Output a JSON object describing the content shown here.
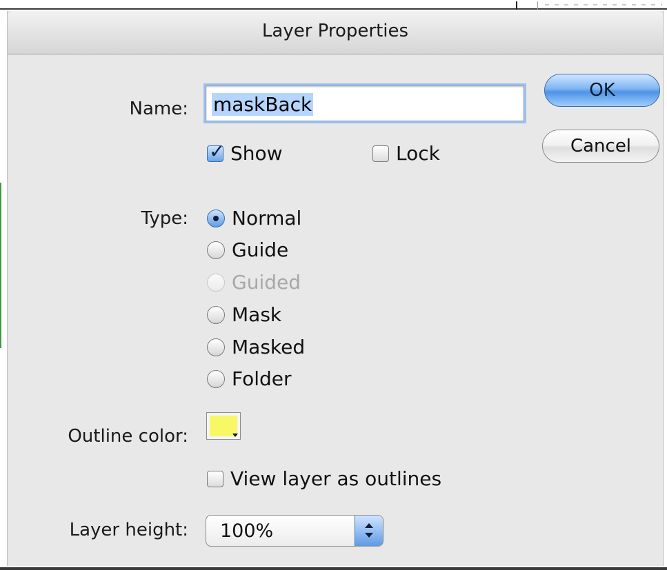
{
  "dialog": {
    "title": "Layer Properties"
  },
  "name_field": {
    "label": "Name:",
    "value": "maskBack"
  },
  "buttons": {
    "ok": "OK",
    "cancel": "Cancel"
  },
  "options": {
    "show": {
      "label": "Show",
      "checked": true
    },
    "lock": {
      "label": "Lock",
      "checked": false
    }
  },
  "type": {
    "label": "Type:",
    "choices": [
      {
        "label": "Normal",
        "selected": true,
        "enabled": true
      },
      {
        "label": "Guide",
        "selected": false,
        "enabled": true
      },
      {
        "label": "Guided",
        "selected": false,
        "enabled": false
      },
      {
        "label": "Mask",
        "selected": false,
        "enabled": true
      },
      {
        "label": "Masked",
        "selected": false,
        "enabled": true
      },
      {
        "label": "Folder",
        "selected": false,
        "enabled": true
      }
    ]
  },
  "outline": {
    "label": "Outline color:",
    "color": "#f8f866",
    "view_as_outlines": {
      "label": "View layer as outlines",
      "checked": false
    }
  },
  "layer_height": {
    "label": "Layer height:",
    "value": "100%"
  },
  "icons": {
    "popup_stepper": "up-down-arrows-icon",
    "swatch_dropdown": "chevron-down-icon"
  }
}
